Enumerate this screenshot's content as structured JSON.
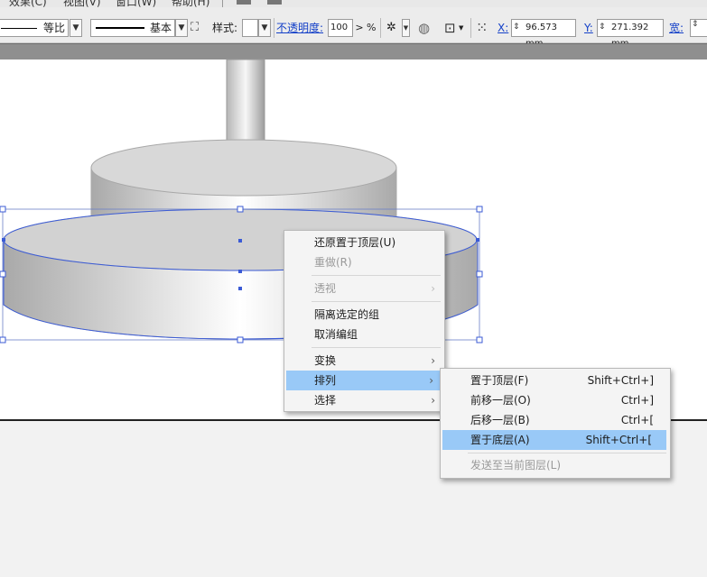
{
  "menubar": {
    "items": [
      "效果(C)",
      "视图(V)",
      "窗口(W)",
      "帮助(H)"
    ]
  },
  "toolbar": {
    "stroke_profile_label": "等比",
    "brush_label": "基本",
    "style_label": "样式:",
    "opacity_label": "不透明度:",
    "opacity_value": "100",
    "percent": "%",
    "x_label": "X:",
    "x_value": "96.573 mm",
    "y_label": "Y:",
    "y_value": "271.392 mm",
    "width_label": "宽:"
  },
  "context_menu": {
    "items": [
      {
        "label": "还原置于顶层(U)",
        "disabled": false,
        "submenu": false
      },
      {
        "label": "重做(R)",
        "disabled": true,
        "submenu": false
      },
      {
        "label": "透视",
        "disabled": true,
        "submenu": true
      },
      {
        "label": "隔离选定的组",
        "disabled": false,
        "submenu": false
      },
      {
        "label": "取消编组",
        "disabled": false,
        "submenu": false
      },
      {
        "label": "变换",
        "disabled": false,
        "submenu": true
      },
      {
        "label": "排列",
        "disabled": false,
        "submenu": true,
        "highlighted": true
      },
      {
        "label": "选择",
        "disabled": false,
        "submenu": true
      }
    ]
  },
  "arrange_submenu": {
    "items": [
      {
        "label": "置于顶层(F)",
        "shortcut": "Shift+Ctrl+]"
      },
      {
        "label": "前移一层(O)",
        "shortcut": "Ctrl+]"
      },
      {
        "label": "后移一层(B)",
        "shortcut": "Ctrl+["
      },
      {
        "label": "置于底层(A)",
        "shortcut": "Shift+Ctrl+[",
        "highlighted": true
      },
      {
        "label": "发送至当前图层(L)",
        "shortcut": "",
        "disabled": true
      }
    ]
  },
  "colors": {
    "highlight": "#99c9f7",
    "selection": "#3b5bd6"
  },
  "icons": {
    "submenu_arrow": "chevron-right-icon"
  }
}
